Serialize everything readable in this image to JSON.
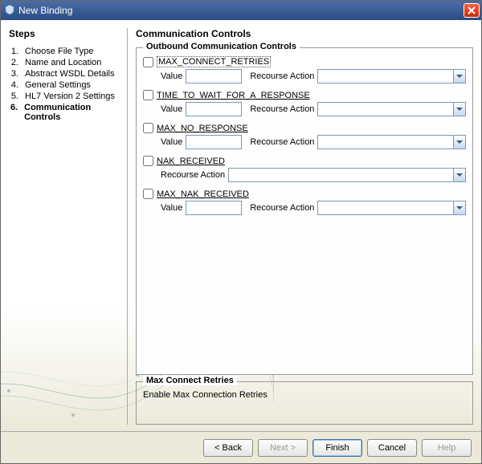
{
  "window": {
    "title": "New Binding"
  },
  "sidebar": {
    "heading": "Steps",
    "items": [
      {
        "num": "1.",
        "label": "Choose File Type"
      },
      {
        "num": "2.",
        "label": "Name and Location"
      },
      {
        "num": "3.",
        "label": "Abstract WSDL Details"
      },
      {
        "num": "4.",
        "label": "General Settings"
      },
      {
        "num": "5.",
        "label": "HL7 Version 2 Settings"
      },
      {
        "num": "6.",
        "label": "Communication Controls",
        "active": true
      }
    ]
  },
  "main": {
    "heading": "Communication Controls",
    "group_title": "Outbound Communication Controls",
    "labels": {
      "value": "Value",
      "recourse": "Recourse Action"
    },
    "controls": [
      {
        "id": "max-connect-retries",
        "name": "MAX_CONNECT_RETRIES",
        "has_value": true,
        "focused": true
      },
      {
        "id": "time-to-wait",
        "name": "TIME_TO_WAIT_FOR_A_RESPONSE",
        "has_value": true
      },
      {
        "id": "max-no-response",
        "name": "MAX_NO_RESPONSE",
        "has_value": true
      },
      {
        "id": "nak-received",
        "name": "NAK_RECEIVED",
        "has_value": false
      },
      {
        "id": "max-nak-received",
        "name": "MAX_NAK_RECEIVED",
        "has_value": true
      }
    ],
    "desc": {
      "title": "Max Connect Retries",
      "text": "Enable Max Connection Retries"
    }
  },
  "buttons": {
    "back": "< Back",
    "next": "Next >",
    "finish": "Finish",
    "cancel": "Cancel",
    "help": "Help"
  }
}
